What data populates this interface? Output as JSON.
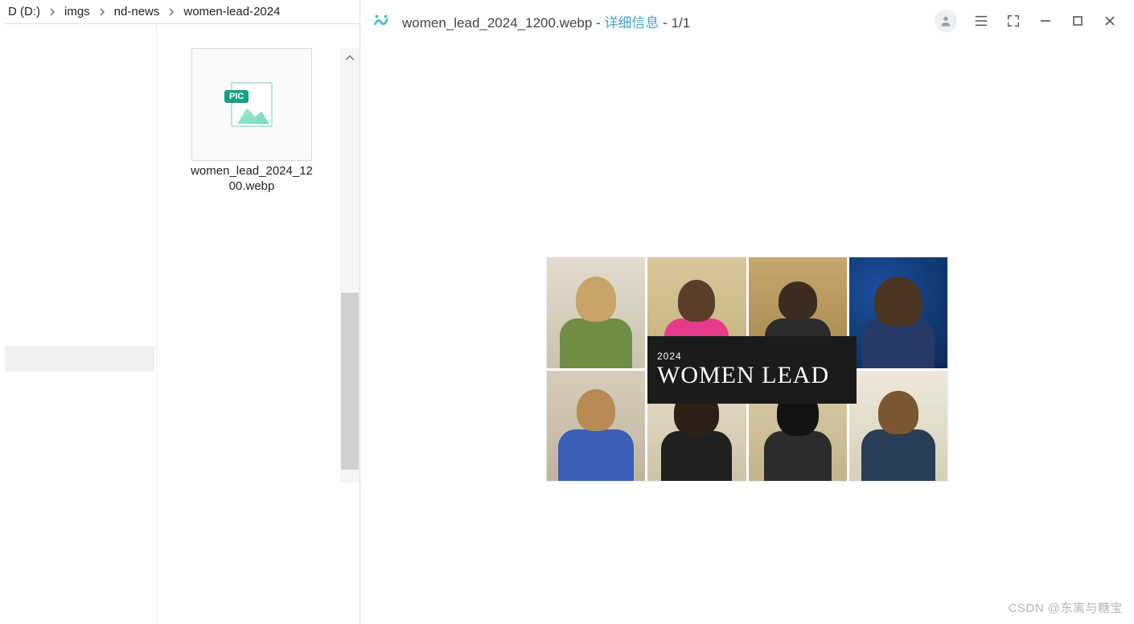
{
  "explorer": {
    "breadcrumb": [
      "D (D:)",
      "imgs",
      "nd-news",
      "women-lead-2024"
    ],
    "file": {
      "name": "women_lead_2024_1200.webp"
    },
    "thumb_tag": "PIC"
  },
  "viewer": {
    "filename": "women_lead_2024_1200.webp",
    "meta_label": "详细信息",
    "counter": "1/1"
  },
  "image": {
    "banner_year": "2024",
    "banner_title": "WOMEN LEAD"
  },
  "watermark": "CSDN @东离与糖宝"
}
